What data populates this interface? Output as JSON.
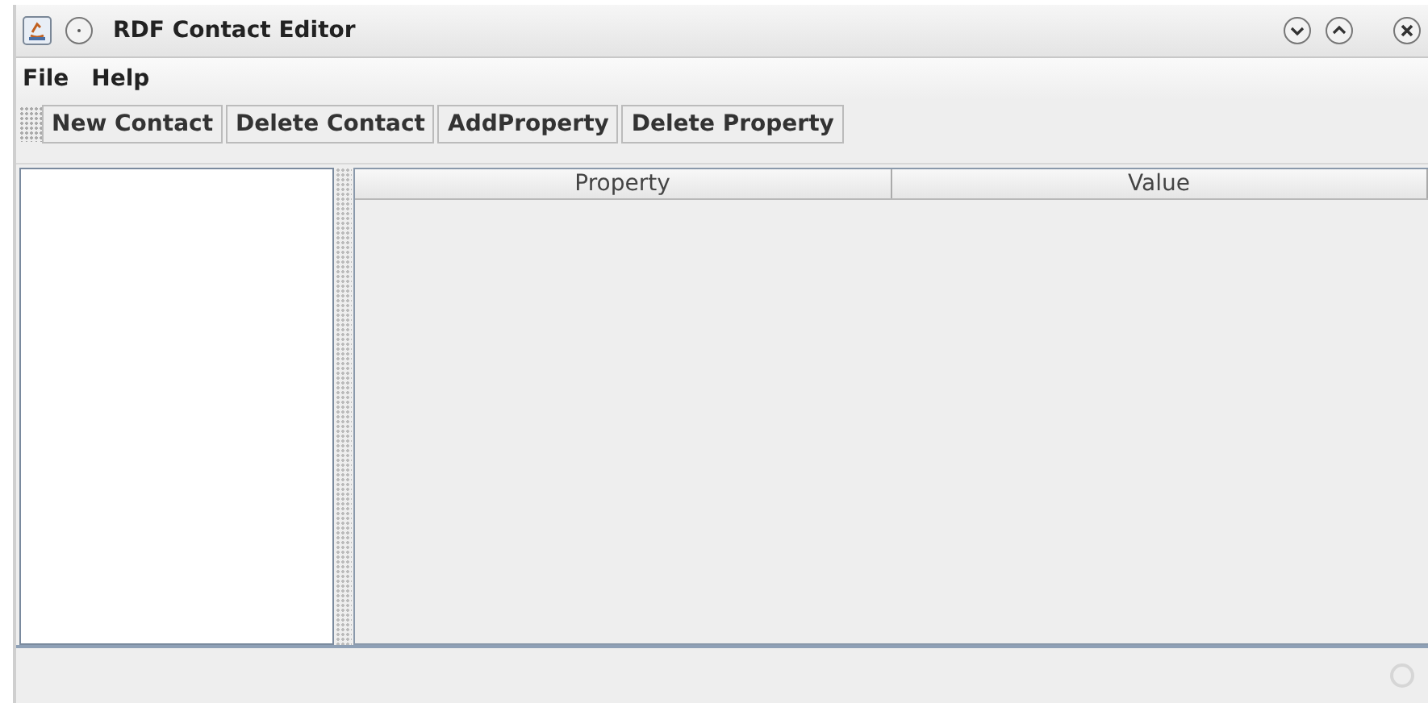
{
  "window": {
    "title": "RDF Contact Editor"
  },
  "menu": [
    "File",
    "Help"
  ],
  "toolbar": [
    "New Contact",
    "Delete Contact",
    "AddProperty",
    "Delete Property"
  ],
  "table": {
    "columns": [
      "Property",
      "Value"
    ]
  }
}
